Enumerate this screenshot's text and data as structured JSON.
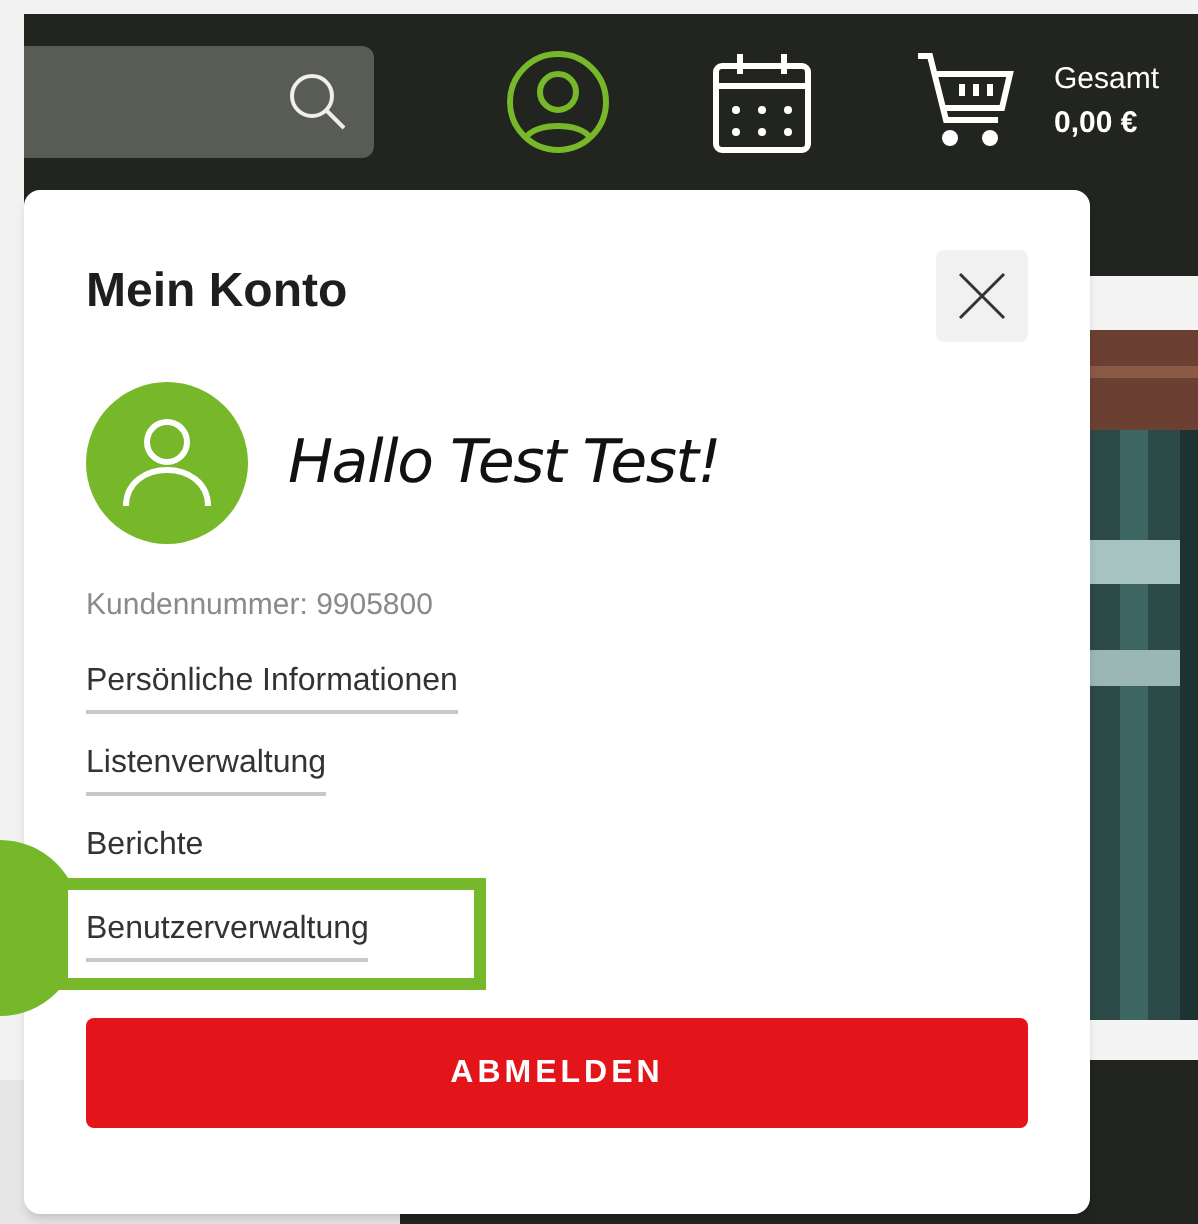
{
  "header": {
    "total_label": "Gesamt",
    "total_value": "0,00 €"
  },
  "account_popup": {
    "title": "Mein Konto",
    "greeting": "Hallo Test Test!",
    "customer_number": "Kundennummer: 9905800",
    "links": [
      {
        "label": "Persönliche Informationen",
        "underlined": true,
        "highlighted": false
      },
      {
        "label": "Listenverwaltung",
        "underlined": true,
        "highlighted": false
      },
      {
        "label": "Berichte",
        "underlined": false,
        "highlighted": false
      },
      {
        "label": "Benutzerverwaltung",
        "underlined": true,
        "highlighted": true
      }
    ],
    "logout_button": "ABMELDEN"
  }
}
